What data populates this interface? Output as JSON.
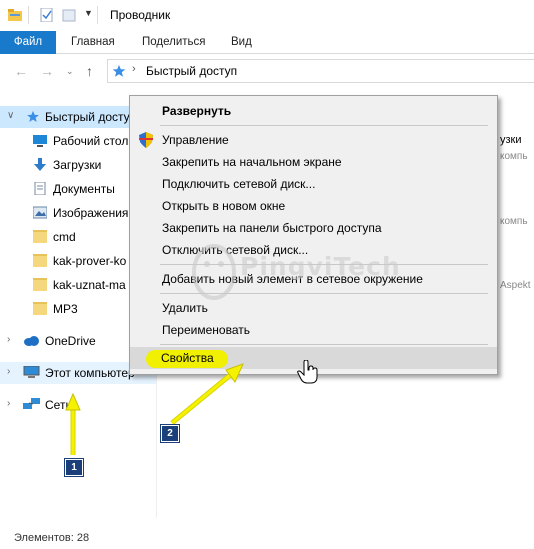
{
  "window": {
    "title": "Проводник"
  },
  "ribbon": {
    "tabs": [
      "Файл",
      "Главная",
      "Поделиться",
      "Вид"
    ]
  },
  "address": {
    "path": "Быстрый доступ"
  },
  "sidebar": {
    "items": [
      {
        "label": "Быстрый доступ",
        "icon": "star-icon"
      },
      {
        "label": "Рабочий стол",
        "icon": "desktop-icon"
      },
      {
        "label": "Загрузки",
        "icon": "download-icon"
      },
      {
        "label": "Документы",
        "icon": "documents-icon"
      },
      {
        "label": "Изображения",
        "icon": "pictures-icon"
      },
      {
        "label": "cmd",
        "icon": "folder-icon"
      },
      {
        "label": "kak-prover-ko",
        "icon": "folder-icon"
      },
      {
        "label": "kak-uznat-ma",
        "icon": "folder-icon"
      },
      {
        "label": "MP3",
        "icon": "folder-icon"
      },
      {
        "label": "OneDrive",
        "icon": "cloud-icon"
      },
      {
        "label": "Этот компьютер",
        "icon": "computer-icon"
      },
      {
        "label": "Сеть",
        "icon": "network-icon"
      }
    ]
  },
  "right_pane": {
    "fragments": [
      "узки",
      "компь",
      "компь",
      "Aspekt"
    ]
  },
  "context_menu": {
    "items": [
      "Развернуть",
      "Управление",
      "Закрепить на начальном экране",
      "Подключить сетевой диск...",
      "Открыть в новом окне",
      "Закрепить на панели быстрого доступа",
      "Отключить сетевой диск...",
      "Добавить новый элемент в сетевое окружение",
      "Удалить",
      "Переименовать",
      "Свойства"
    ]
  },
  "watermark": {
    "text": "PingviTech"
  },
  "annotations": {
    "badges": [
      "1",
      "2"
    ],
    "accent_color": "#f0f000",
    "badge_color": "#1a3f7a"
  },
  "status": {
    "items_count": "Элементов: 28"
  },
  "colors": {
    "file_tab": "#1979ca",
    "selection": "#cce8ff"
  }
}
